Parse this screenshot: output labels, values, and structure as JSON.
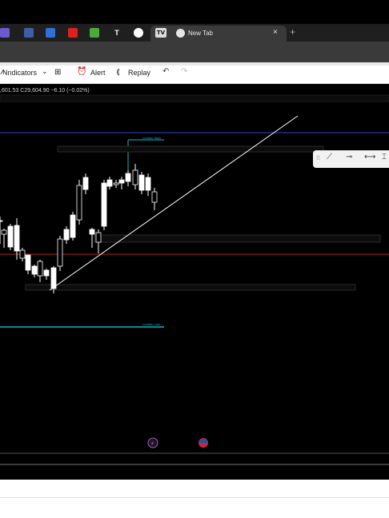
{
  "browser": {
    "active_tab_title": "New Tab",
    "tab_close": "×",
    "new_tab": "+"
  },
  "toolbar": {
    "indicators_label": "Indicators",
    "alert_label": "Alert",
    "replay_label": "Replay"
  },
  "chart": {
    "quote": ",601.53 C29,604.90 −6.10 (−0.02%)",
    "label_high": "London High",
    "label_low": "London Low"
  },
  "colors": {
    "candle": "#ffffff",
    "trend_line": "#ffffff",
    "blue_line": "#2b3fd6",
    "red_line": "#b8211f",
    "cyan_line": "#17b3c7"
  }
}
